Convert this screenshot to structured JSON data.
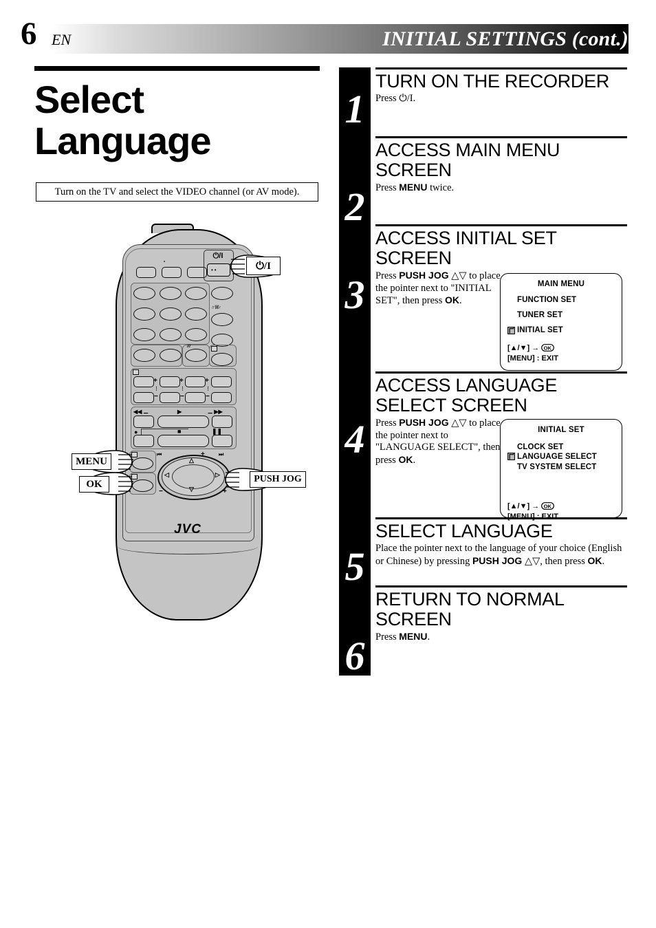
{
  "header": {
    "page_number": "6",
    "language_code": "EN",
    "title": "INITIAL SETTINGS (cont.)"
  },
  "left": {
    "heading_line1": "Select",
    "heading_line2": "Language",
    "note": "Turn on the TV and select the VIDEO channel (or AV mode).",
    "remote": {
      "brand": "JVC",
      "power_label": "⏻/I",
      "callouts": [
        {
          "name": "power",
          "label": "⏻/I"
        },
        {
          "name": "menu",
          "label": "MENU"
        },
        {
          "name": "ok",
          "label": "OK"
        },
        {
          "name": "push-jog",
          "label": "PUSH JOG"
        }
      ]
    }
  },
  "steps": [
    {
      "number": "1",
      "heading": "TURN ON THE RECORDER",
      "body_html": "Press ⏻/I.",
      "osd": null
    },
    {
      "number": "2",
      "heading": "ACCESS MAIN MENU SCREEN",
      "body_html": "Press <b>MENU</b> twice.",
      "osd": null
    },
    {
      "number": "3",
      "heading": "ACCESS INITIAL SET SCREEN",
      "body_html": "Press <b>PUSH JOG</b> △▽ to place the pointer next to \"INITIAL SET\", then press <b>OK</b>.",
      "osd": {
        "title": "MAIN MENU",
        "items": [
          {
            "label": "FUNCTION SET",
            "selected": false
          },
          {
            "label": "TUNER SET",
            "selected": false
          },
          {
            "label": "INITIAL SET",
            "selected": true
          }
        ],
        "footer_line1_prefix": "[▲/▼] → ",
        "footer_line1_icon": "OK",
        "footer_line2": "[MENU] : EXIT"
      }
    },
    {
      "number": "4",
      "heading": "ACCESS LANGUAGE SELECT SCREEN",
      "body_html": "Press <b>PUSH JOG</b> △▽ to place the pointer next to \"LANGUAGE SELECT\", then press <b>OK</b>.",
      "osd": {
        "title": "INITIAL SET",
        "items": [
          {
            "label": "CLOCK SET",
            "selected": false
          },
          {
            "label": "LANGUAGE SELECT",
            "selected": true
          },
          {
            "label": "TV SYSTEM SELECT",
            "selected": false
          }
        ],
        "footer_line1_prefix": "[▲/▼] → ",
        "footer_line1_icon": "OK",
        "footer_line2": "[MENU] : EXIT"
      }
    },
    {
      "number": "5",
      "heading": "SELECT LANGUAGE",
      "body_html": "Place the pointer next to the language of your choice (English or Chinese) by pressing <b>PUSH JOG</b> △▽, then press <b>OK</b>.",
      "osd": null
    },
    {
      "number": "6",
      "heading": "RETURN TO NORMAL SCREEN",
      "body_html": "Press <b>MENU</b>.",
      "osd": null
    }
  ],
  "colors": {
    "ink": "#000000",
    "remote_body": "#c4c4c4",
    "paper": "#ffffff"
  }
}
